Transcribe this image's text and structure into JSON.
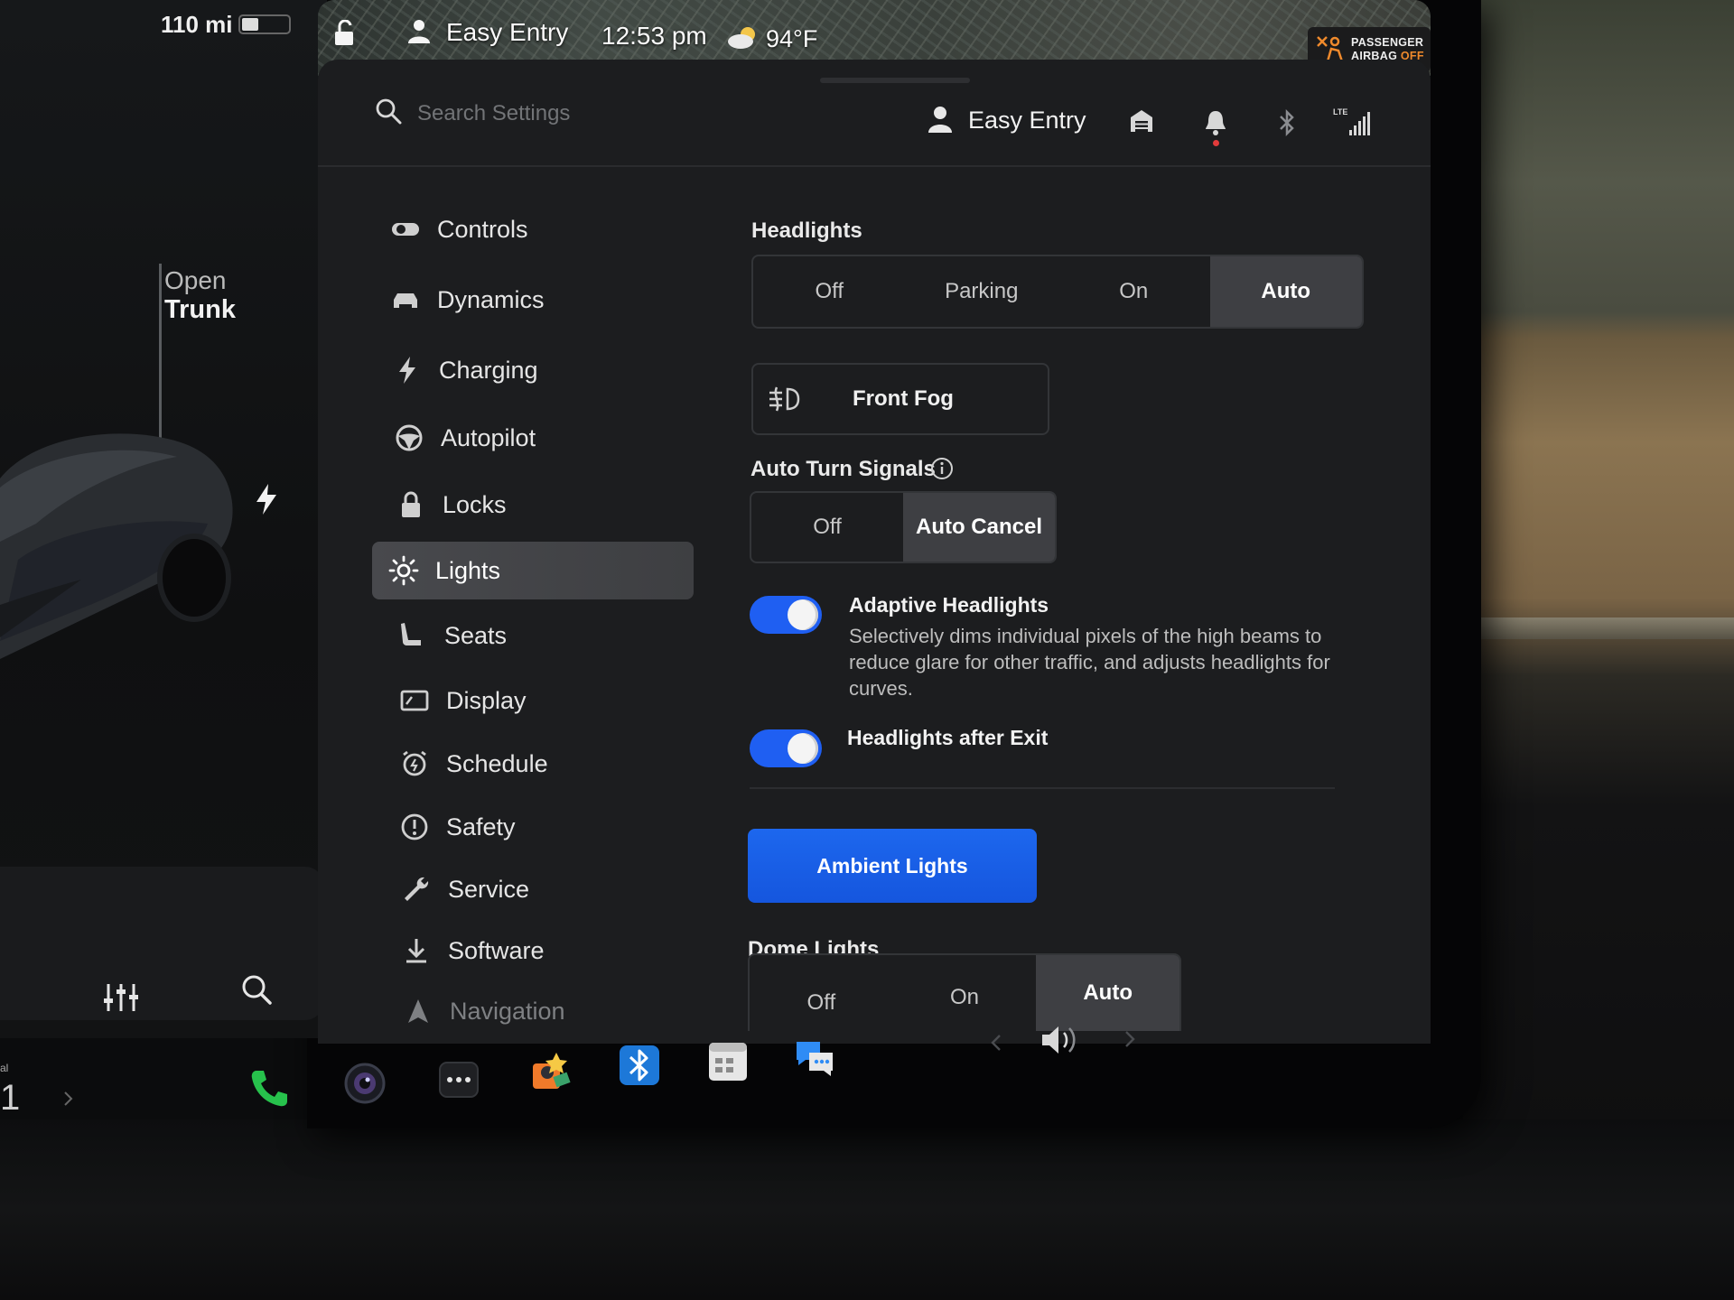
{
  "vehicle": {
    "range": "110 mi",
    "battery_level": 0.35,
    "trunk_action": "Open",
    "trunk_label": "Trunk"
  },
  "status_bar": {
    "profile": "Easy Entry",
    "time": "12:53 pm",
    "temperature": "94°F",
    "airbag_line1": "PASSENGER",
    "airbag_line2_prefix": "AIRBAG",
    "airbag_line2_status": "OFF",
    "airbag_status_color": "#f08a2c"
  },
  "header": {
    "search_placeholder": "Search Settings",
    "profile": "Easy Entry",
    "network": "LTE"
  },
  "sidebar": {
    "items": [
      {
        "label": "Controls",
        "icon": "toggle-icon"
      },
      {
        "label": "Dynamics",
        "icon": "car-icon"
      },
      {
        "label": "Charging",
        "icon": "bolt-icon"
      },
      {
        "label": "Autopilot",
        "icon": "steering-wheel-icon"
      },
      {
        "label": "Locks",
        "icon": "lock-icon"
      },
      {
        "label": "Lights",
        "icon": "sun-icon",
        "active": true
      },
      {
        "label": "Seats",
        "icon": "seat-icon"
      },
      {
        "label": "Display",
        "icon": "display-icon"
      },
      {
        "label": "Schedule",
        "icon": "alarm-clock-icon"
      },
      {
        "label": "Safety",
        "icon": "alert-circle-icon"
      },
      {
        "label": "Service",
        "icon": "wrench-icon"
      },
      {
        "label": "Software",
        "icon": "download-icon"
      },
      {
        "label": "Navigation",
        "icon": "navigation-arrow-icon"
      }
    ]
  },
  "lights": {
    "headlights": {
      "label": "Headlights",
      "options": [
        "Off",
        "Parking",
        "On",
        "Auto"
      ],
      "selected": "Auto"
    },
    "front_fog": {
      "label": "Front Fog",
      "icon": "fog-light-icon"
    },
    "auto_turn_signals": {
      "label": "Auto Turn Signals",
      "options": [
        "Off",
        "Auto Cancel"
      ],
      "selected": "Auto Cancel"
    },
    "adaptive_headlights": {
      "title": "Adaptive Headlights",
      "description": "Selectively dims individual pixels of the high beams to reduce glare for other traffic, and adjusts headlights for curves.",
      "enabled": true
    },
    "headlights_after_exit": {
      "title": "Headlights after Exit",
      "enabled": true
    },
    "ambient_lights_button": "Ambient Lights",
    "dome_lights": {
      "label": "Dome Lights",
      "options": [
        "Off",
        "On",
        "Auto"
      ],
      "selected": "Auto"
    }
  },
  "taskbar": {
    "icons": [
      "phone-icon",
      "camera-icon",
      "more-apps-icon",
      "toybox-icon",
      "bluetooth-icon",
      "calendar-icon",
      "messages-icon"
    ],
    "left_label": "al",
    "left_number": "1"
  },
  "colors": {
    "accent": "#1f5ff2",
    "selected_segment": "#3e3f43",
    "background": "#1c1d1f"
  }
}
